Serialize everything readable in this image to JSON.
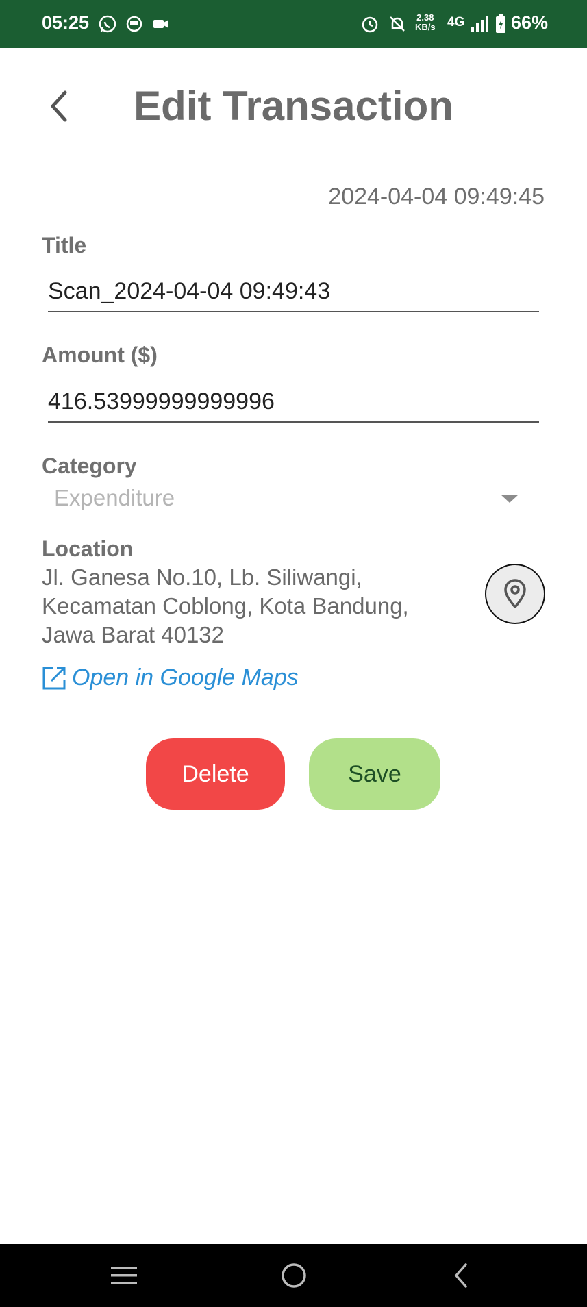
{
  "status_bar": {
    "time": "05:25",
    "speed_value": "2.38",
    "speed_unit": "KB/s",
    "network": "4G",
    "battery": "66%",
    "icons": [
      "whatsapp-icon",
      "chat-icon",
      "video-icon",
      "alarm-icon",
      "bell-off-icon",
      "signal-icon",
      "battery-charging-icon"
    ]
  },
  "header": {
    "title": "Edit Transaction",
    "back_icon": "chevron-left-icon"
  },
  "transaction": {
    "timestamp": "2024-04-04 09:49:45",
    "title_label": "Title",
    "title_value": "Scan_2024-04-04 09:49:43",
    "amount_label": "Amount ($)",
    "amount_value": "416.53999999999996",
    "category_label": "Category",
    "category_value": "Expenditure",
    "location_label": "Location",
    "location_line1": "Jl. Ganesa No.10, Lb. Siliwangi,",
    "location_line2": "Kecamatan Coblong, Kota Bandung,",
    "location_line3": "Jawa Barat 40132",
    "maps_link": "Open in Google Maps"
  },
  "actions": {
    "delete_label": "Delete",
    "save_label": "Save"
  },
  "nav_bar": {
    "items": [
      "menu-icon",
      "home-icon",
      "back-icon"
    ]
  },
  "colors": {
    "status_bar": "#1b5e32",
    "delete": "#f24747",
    "save": "#b2e08a",
    "link": "#2a8fd6"
  }
}
